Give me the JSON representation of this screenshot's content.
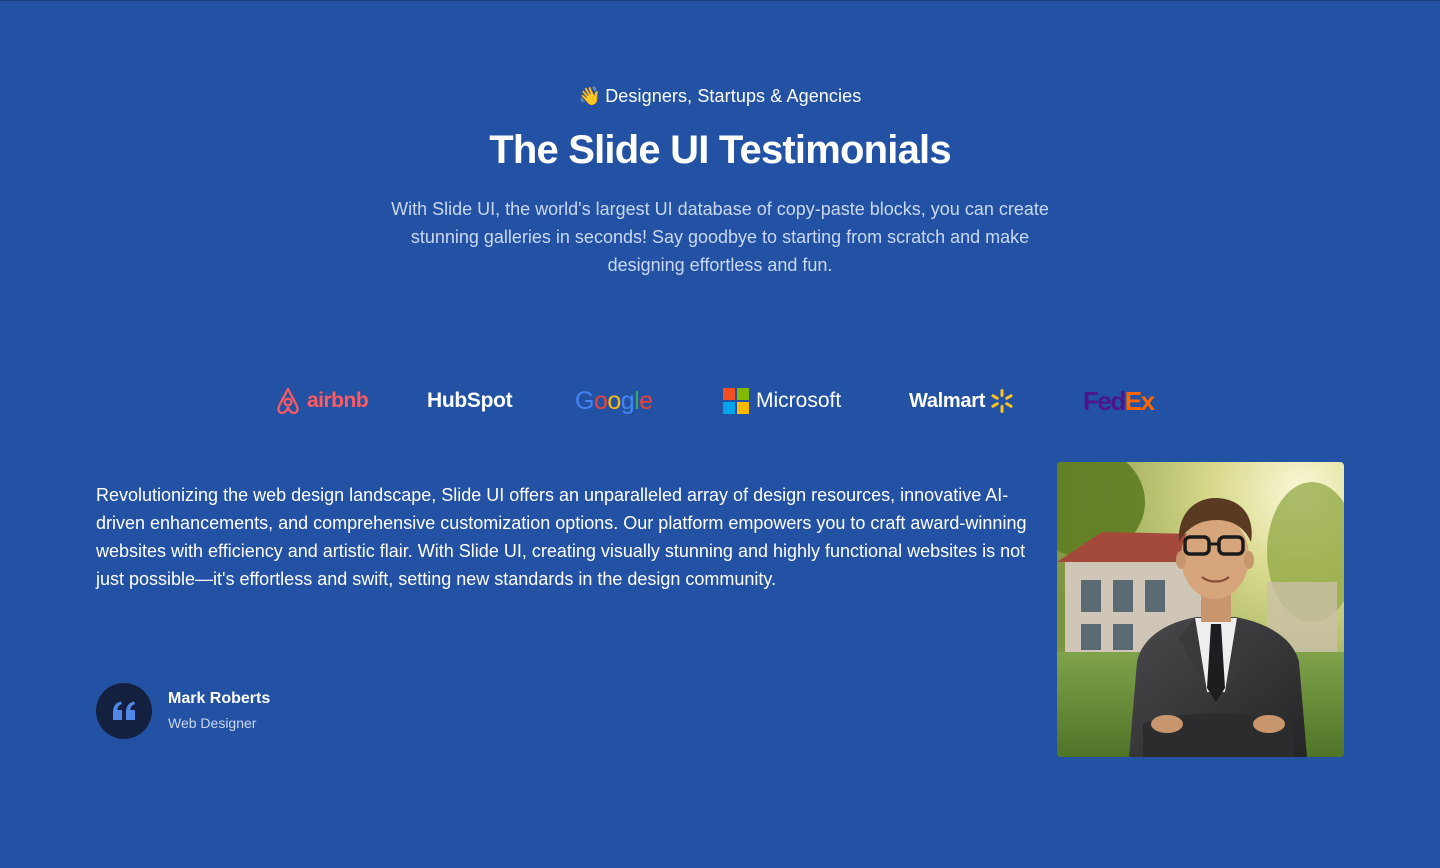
{
  "header": {
    "eyebrow_emoji": "👋",
    "eyebrow": "Designers, Startups & Agencies",
    "title": "The Slide UI Testimonials",
    "subtitle": "With Slide UI, the world's largest UI database of copy-paste blocks, you can create stunning galleries in seconds! Say goodbye to starting from scratch and make designing effortless and fun."
  },
  "logos": {
    "airbnb": "airbnb",
    "hubspot": "HubSpot",
    "google": [
      "G",
      "o",
      "o",
      "g",
      "l",
      "e"
    ],
    "microsoft": "Microsoft",
    "walmart": "Walmart",
    "fedex_fed": "Fed",
    "fedex_ex": "Ex"
  },
  "testimonial": {
    "text": "Revolutionizing the web design landscape, Slide UI offers an unparalleled array of design resources, innovative AI-driven enhancements, and comprehensive customization options. Our platform empowers you to craft award-winning websites with efficiency and artistic flair. With Slide UI, creating visually stunning and highly functional websites is not just possible—it's effortless and swift, setting new standards in the design community.",
    "author_name": "Mark Roberts",
    "author_role": "Web Designer",
    "quote_icon": "quote-icon",
    "portrait_alt": "Mark Roberts"
  },
  "colors": {
    "background": "#2352a4",
    "subtitle": "#c9d8f3",
    "quote_badge": "#13203f",
    "airbnb": "#ff5a5f",
    "fedex_purple": "#4d148c",
    "fedex_orange": "#ff6600"
  }
}
